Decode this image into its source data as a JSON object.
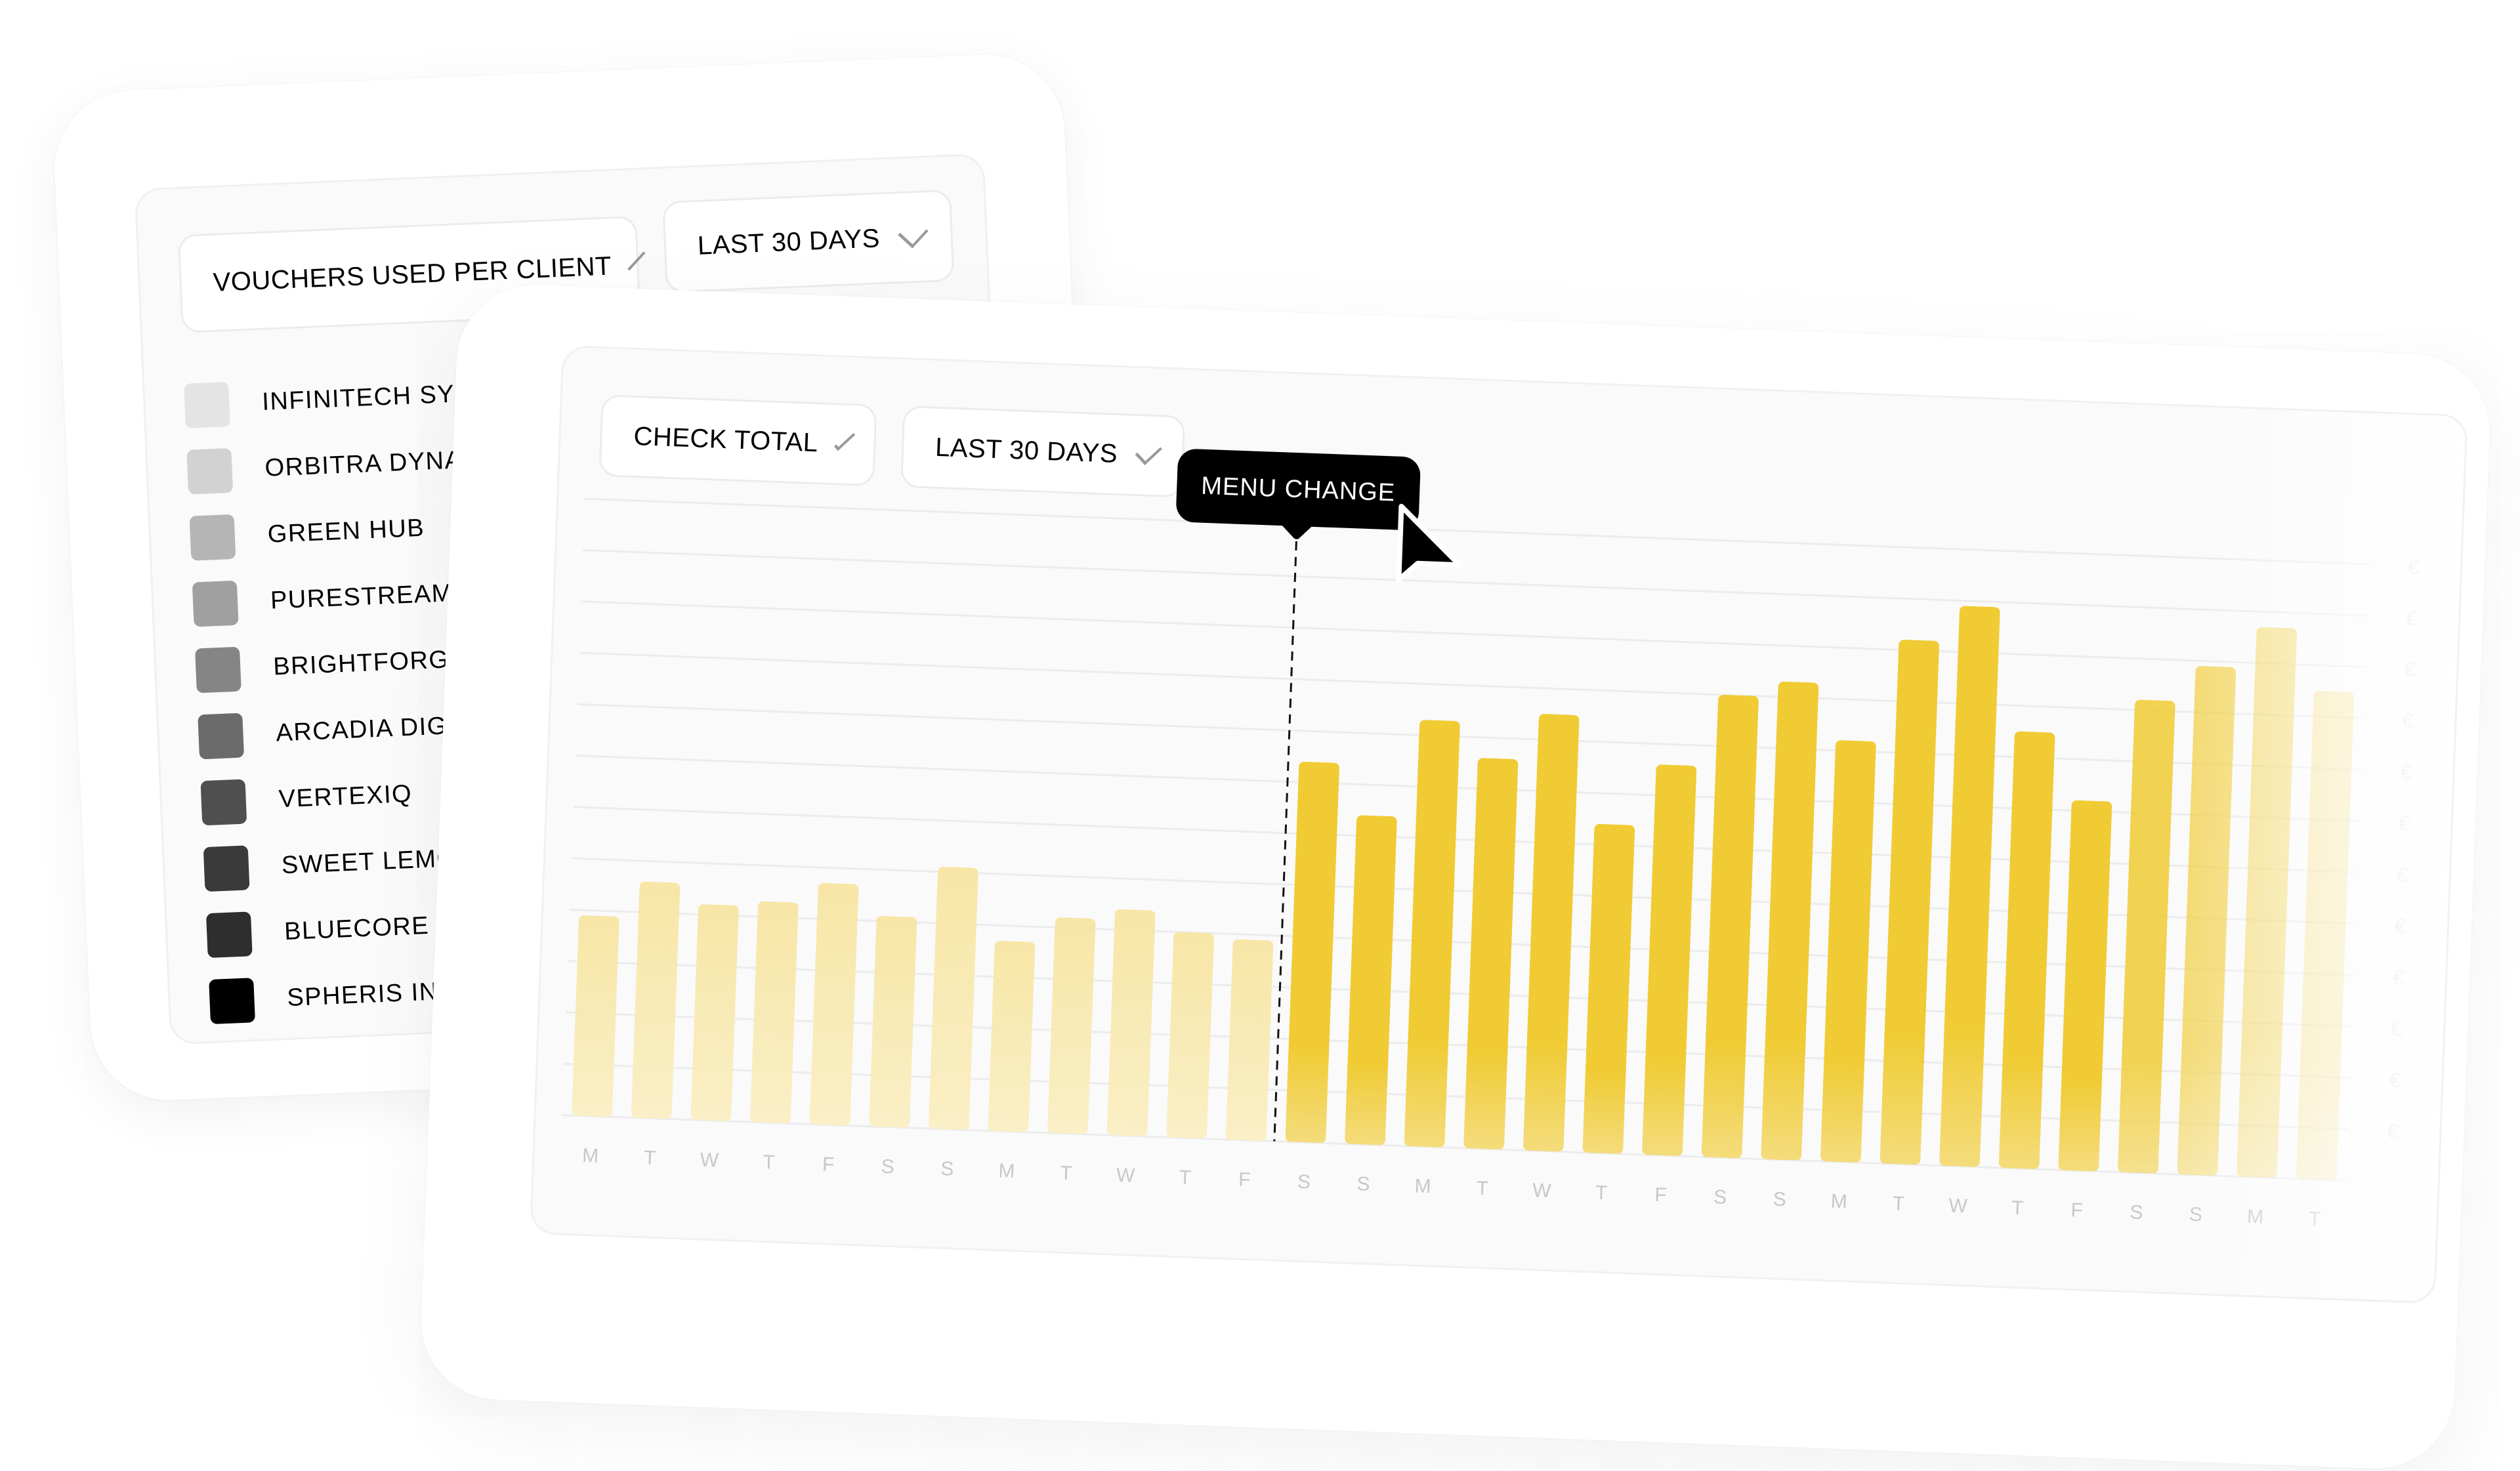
{
  "back_card": {
    "metric_dropdown": {
      "label": "VOUCHERS USED PER CLIENT",
      "icon": "chevron-down-icon"
    },
    "range_dropdown": {
      "label": "LAST 30 DAYS",
      "icon": "chevron-down-icon"
    },
    "legend": [
      {
        "label": "INFINITECH SYSTE",
        "color": "#e4e4e4"
      },
      {
        "label": "ORBITRA DYNAMIC",
        "color": "#d2d2d2"
      },
      {
        "label": "GREEN HUB",
        "color": "#b5b5b5"
      },
      {
        "label": "PURESTREAM VEI",
        "color": "#a0a0a0"
      },
      {
        "label": "BRIGHTFORGE EN",
        "color": "#858585"
      },
      {
        "label": "ARCADIA DIGITA",
        "color": "#6b6b6b"
      },
      {
        "label": "VERTEXIQ",
        "color": "#4f4f4f"
      },
      {
        "label": "SWEET LEMON",
        "color": "#3a3a3a"
      },
      {
        "label": "BLUECORE",
        "color": "#2e2e2e"
      },
      {
        "label": "SPHERIS INSIGI",
        "color": "#000000"
      }
    ]
  },
  "front_card": {
    "metric_dropdown": {
      "label": "CHECK TOTAL",
      "icon": "chevron-down-icon"
    },
    "range_dropdown": {
      "label": "LAST 30 DAYS",
      "icon": "chevron-down-icon"
    },
    "tooltip": {
      "label": "MENU CHANGE"
    },
    "cursor": "mouse-pointer-icon"
  },
  "colors": {
    "before_bar": "#f7e6a6",
    "after_bar": "#f0cb33",
    "tooltip_bg": "#000000"
  },
  "chart_data": {
    "type": "bar",
    "title": "CHECK TOTAL",
    "xlabel": "",
    "ylabel": "€",
    "ylim": [
      0,
      12
    ],
    "grid": true,
    "y_tick_labels": [
      "€",
      "€",
      "€",
      "€",
      "€",
      "€",
      "€",
      "€",
      "€",
      "€",
      "€",
      "€"
    ],
    "y_axis_side": "right",
    "categories": [
      "M",
      "T",
      "W",
      "T",
      "F",
      "S",
      "S",
      "M",
      "T",
      "W",
      "T",
      "F",
      "S",
      "S",
      "M",
      "T",
      "W",
      "T",
      "F",
      "S",
      "S",
      "M",
      "T",
      "W",
      "T",
      "F",
      "S",
      "S",
      "M",
      "T"
    ],
    "series": [
      {
        "name": "Check total",
        "values": [
          3.9,
          4.6,
          4.2,
          4.3,
          4.7,
          4.1,
          5.1,
          3.7,
          4.2,
          4.4,
          4.0,
          3.9,
          7.4,
          6.4,
          8.3,
          7.6,
          8.5,
          6.4,
          7.6,
          9.0,
          9.3,
          8.2,
          10.2,
          10.9,
          8.5,
          7.2,
          9.2,
          9.9,
          10.7,
          9.5
        ]
      }
    ],
    "annotations": [
      {
        "text": "MENU CHANGE",
        "at_index": 12,
        "style": "dashed-vertical-line"
      }
    ],
    "highlight_from_index": 12
  }
}
